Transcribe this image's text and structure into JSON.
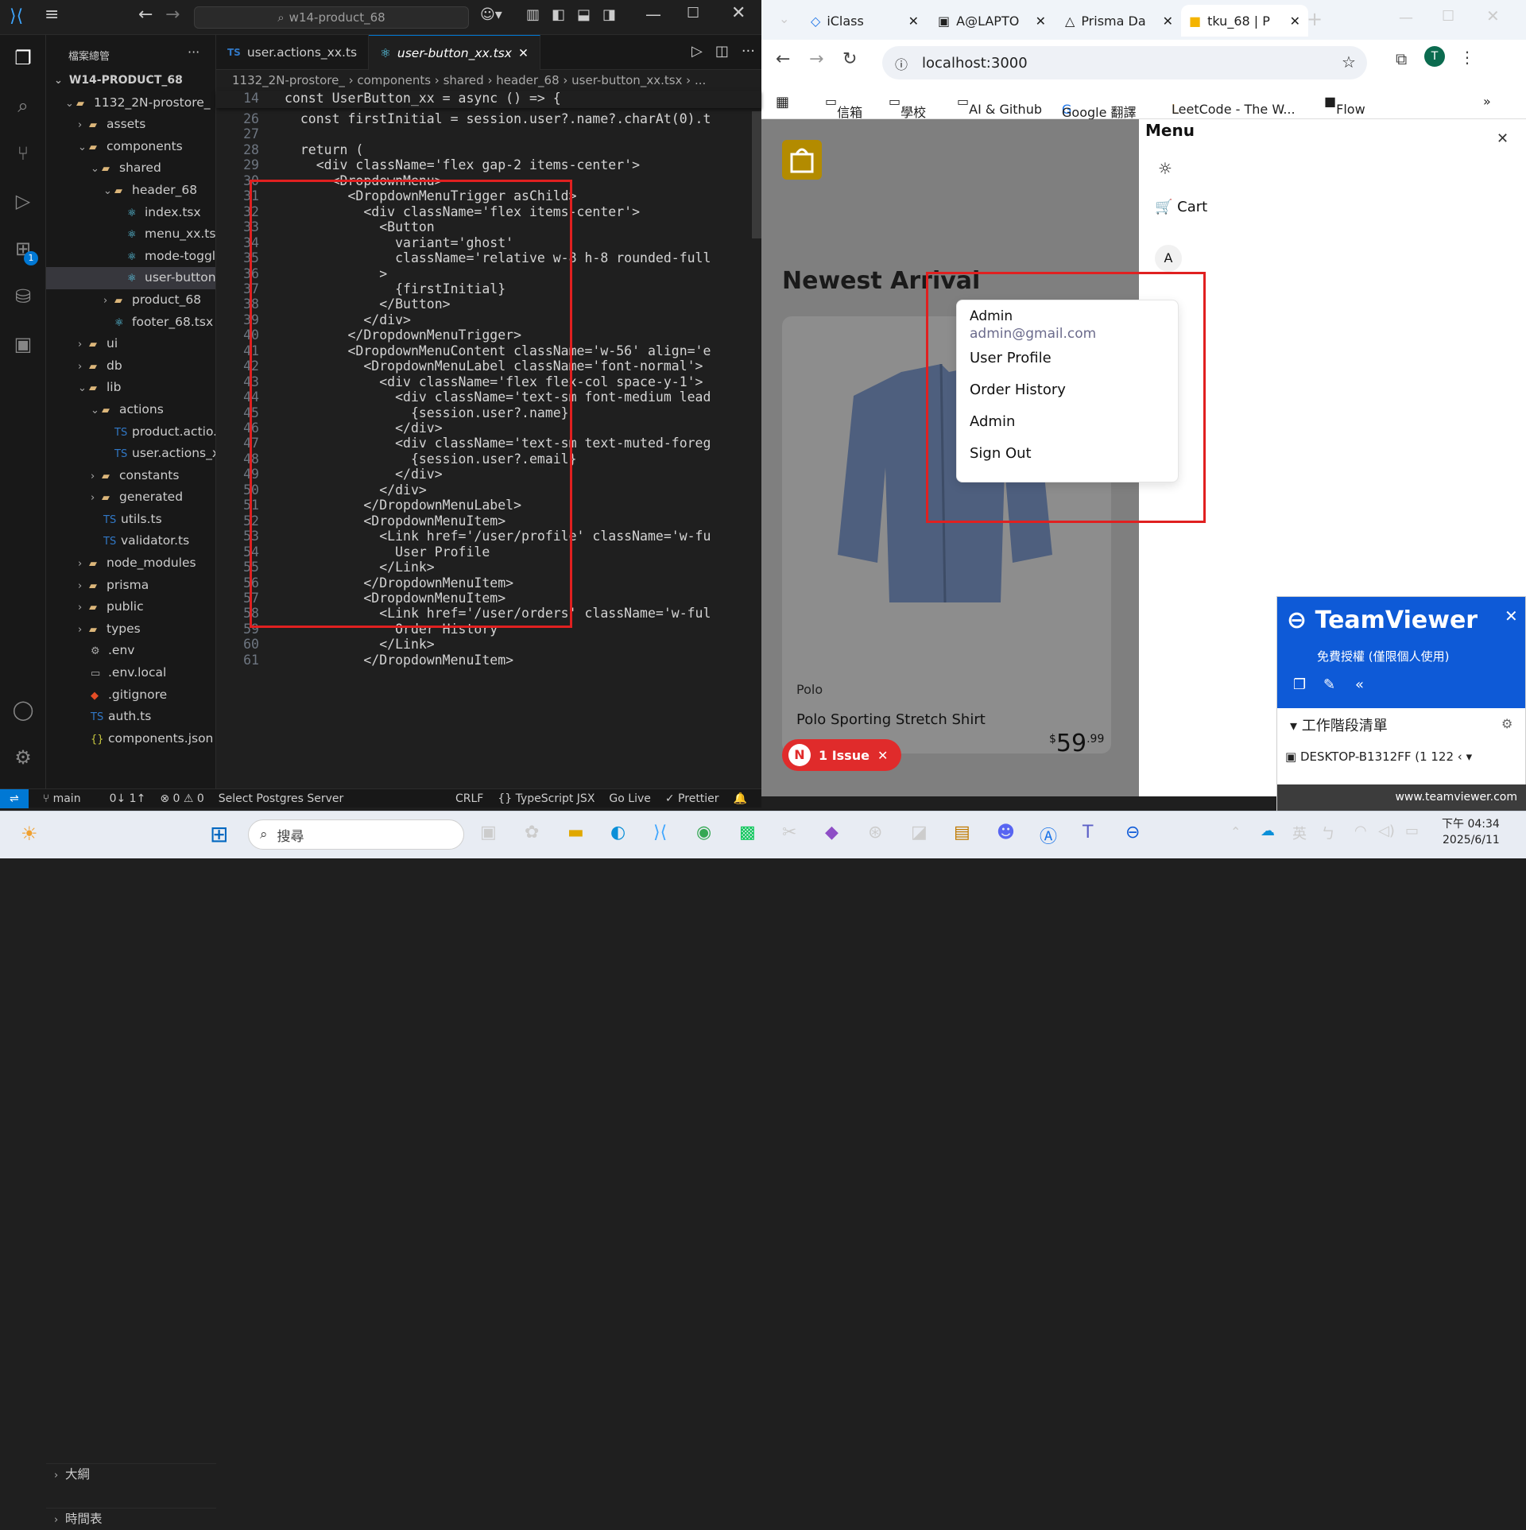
{
  "vscode": {
    "search": "w14-product_68",
    "explorer_title": "檔案總管",
    "project": "W14-PRODUCT_68",
    "tree": [
      {
        "name": "1132_2N-prostore_",
        "icon": "folder-icon"
      },
      {
        "name": "assets",
        "icon": "folder-icon"
      },
      {
        "name": "components",
        "icon": "folder-icon"
      },
      {
        "name": "shared",
        "icon": "folder-icon"
      },
      {
        "name": "header_68",
        "icon": "folder-icon"
      },
      {
        "name": "index.tsx",
        "icon": "react-file-icon"
      },
      {
        "name": "menu_xx.tsx",
        "icon": "react-file-icon"
      },
      {
        "name": "mode-toggl...",
        "icon": "react-file-icon"
      },
      {
        "name": "user-button...",
        "icon": "react-file-icon"
      },
      {
        "name": "product_68",
        "icon": "folder-icon"
      },
      {
        "name": "footer_68.tsx",
        "icon": "react-file-icon"
      },
      {
        "name": "ui",
        "icon": "folder-icon"
      },
      {
        "name": "db",
        "icon": "folder-icon"
      },
      {
        "name": "lib",
        "icon": "folder-icon"
      },
      {
        "name": "actions",
        "icon": "folder-icon"
      },
      {
        "name": "product.actio...",
        "icon": "ts-file-icon"
      },
      {
        "name": "user.actions_x...",
        "icon": "ts-file-icon"
      },
      {
        "name": "constants",
        "icon": "folder-icon"
      },
      {
        "name": "generated",
        "icon": "folder-icon"
      },
      {
        "name": "utils.ts",
        "icon": "ts-file-icon"
      },
      {
        "name": "validator.ts",
        "icon": "ts-file-icon"
      },
      {
        "name": "node_modules",
        "icon": "folder-icon"
      },
      {
        "name": "prisma",
        "icon": "folder-icon"
      },
      {
        "name": "public",
        "icon": "folder-icon"
      },
      {
        "name": "types",
        "icon": "folder-icon"
      },
      {
        "name": ".env",
        "icon": "gear-icon"
      },
      {
        "name": ".env.local",
        "icon": "env-file-icon"
      },
      {
        "name": ".gitignore",
        "icon": "git-icon"
      },
      {
        "name": "auth.ts",
        "icon": "ts-file-icon"
      },
      {
        "name": "components.json",
        "icon": "json-file-icon"
      }
    ],
    "outline": "大綱",
    "timeline": "時間表",
    "tabs": [
      {
        "label": "user.actions_xx.ts"
      },
      {
        "label": "user-button_xx.tsx"
      }
    ],
    "breadcrumb": "1132_2N-prostore_ › components › shared › header_68 › user-button_xx.tsx › ...",
    "sticky_line": {
      "no": "14",
      "text": "const UserButton_xx = async () => {"
    },
    "code": [
      {
        "no": "26",
        "text": "  const firstInitial = session.user?.name?.charAt(0).t"
      },
      {
        "no": "27",
        "text": ""
      },
      {
        "no": "28",
        "text": "  return ("
      },
      {
        "no": "29",
        "text": "    <div className='flex gap-2 items-center'>"
      },
      {
        "no": "30",
        "text": "      <DropdownMenu>"
      },
      {
        "no": "31",
        "text": "        <DropdownMenuTrigger asChild>"
      },
      {
        "no": "32",
        "text": "          <div className='flex items-center'>"
      },
      {
        "no": "33",
        "text": "            <Button"
      },
      {
        "no": "34",
        "text": "              variant='ghost'"
      },
      {
        "no": "35",
        "text": "              className='relative w-8 h-8 rounded-full"
      },
      {
        "no": "36",
        "text": "            >"
      },
      {
        "no": "37",
        "text": "              {firstInitial}"
      },
      {
        "no": "38",
        "text": "            </Button>"
      },
      {
        "no": "39",
        "text": "          </div>"
      },
      {
        "no": "40",
        "text": "        </DropdownMenuTrigger>"
      },
      {
        "no": "41",
        "text": "        <DropdownMenuContent className='w-56' align='e"
      },
      {
        "no": "42",
        "text": "          <DropdownMenuLabel className='font-normal'>"
      },
      {
        "no": "43",
        "text": "            <div className='flex flex-col space-y-1'>"
      },
      {
        "no": "44",
        "text": "              <div className='text-sm font-medium lead"
      },
      {
        "no": "45",
        "text": "                {session.user?.name}"
      },
      {
        "no": "46",
        "text": "              </div>"
      },
      {
        "no": "47",
        "text": "              <div className='text-sm text-muted-foreg"
      },
      {
        "no": "48",
        "text": "                {session.user?.email}"
      },
      {
        "no": "49",
        "text": "              </div>"
      },
      {
        "no": "50",
        "text": "            </div>"
      },
      {
        "no": "51",
        "text": "          </DropdownMenuLabel>"
      },
      {
        "no": "52",
        "text": "          <DropdownMenuItem>"
      },
      {
        "no": "53",
        "text": "            <Link href='/user/profile' className='w-fu"
      },
      {
        "no": "54",
        "text": "              User Profile"
      },
      {
        "no": "55",
        "text": "            </Link>"
      },
      {
        "no": "56",
        "text": "          </DropdownMenuItem>"
      },
      {
        "no": "57",
        "text": "          <DropdownMenuItem>"
      },
      {
        "no": "58",
        "text": "            <Link href='/user/orders' className='w-ful"
      },
      {
        "no": "59",
        "text": "              Order History"
      },
      {
        "no": "60",
        "text": "            </Link>"
      },
      {
        "no": "61",
        "text": "          </DropdownMenuItem>"
      }
    ],
    "status": {
      "branch": "main",
      "sync": "0↓ 1↑",
      "problems": "⊗ 0 ⚠ 0",
      "db": "Select Postgres Server",
      "eol": "CRLF",
      "lang": "{} TypeScript JSX",
      "golive": "Go Live",
      "prettier": "✓ Prettier"
    }
  },
  "chrome": {
    "tabs": [
      {
        "label": "iClass"
      },
      {
        "label": "A@LAPTO"
      },
      {
        "label": "Prisma Da"
      },
      {
        "label": "tku_68 | P"
      }
    ],
    "url": "localhost:3000",
    "bookmarks": [
      "信箱",
      "學校",
      "AI & Github",
      "Google 翻譯",
      "LeetCode - The W...",
      "Flow"
    ],
    "page": {
      "heading": "Newest Arrival",
      "brand": "Polo",
      "product_name": "Polo Sporting Stretch Shirt",
      "price_whole": "59",
      "price_cents": ".99",
      "issue_badge": "1 Issue",
      "issue_avatar": "N"
    },
    "drawer": {
      "title": "Menu",
      "cart": "Cart",
      "avatar": "A",
      "dropdown": {
        "name": "Admin",
        "email": "admin@gmail.com",
        "items": [
          "User Profile",
          "Order History",
          "Admin",
          "Sign Out"
        ]
      }
    }
  },
  "teamviewer": {
    "title": "TeamViewer",
    "license": "免費授權 (僅限個人使用)",
    "session_list": "工作階段清單",
    "device": "DESKTOP-B1312FF (1 122 ‹",
    "link": "www.teamviewer.com"
  },
  "taskbar": {
    "search": "搜尋",
    "lang": "英",
    "time": "下午 04:34",
    "date": "2025/6/11"
  }
}
